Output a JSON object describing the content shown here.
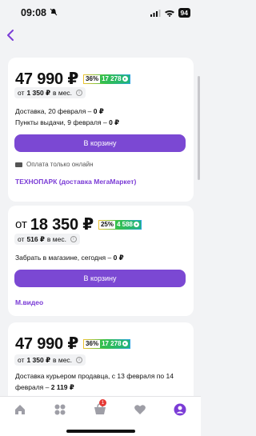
{
  "status": {
    "time": "09:08",
    "battery": "94"
  },
  "offers": [
    {
      "price": "47 990 ₽",
      "prefix": "",
      "bonus_pct": "36%",
      "bonus_pts": "17 278",
      "installment_prefix": "от",
      "installment_amount": "1 350 ₽",
      "installment_suffix": "в мес.",
      "delivery_line": "Доставка, 20 февраля –",
      "delivery_price": "0 ₽",
      "pickup_line": "Пункты выдачи, 9 февраля –",
      "pickup_price": "0 ₽",
      "cart_label": "В корзину",
      "payment_note": "Оплата только онлайн",
      "seller": "ТЕХНОПАРК (доставка МегаМаркет)"
    },
    {
      "price": "18 350 ₽",
      "prefix": "от",
      "bonus_pct": "25%",
      "bonus_pts": "4 588",
      "installment_prefix": "от",
      "installment_amount": "516 ₽",
      "installment_suffix": "в мес.",
      "store_line": "Забрать в магазине, сегодня –",
      "store_price": "0 ₽",
      "cart_label": "В корзину",
      "seller": "М.видео"
    },
    {
      "price": "47 990 ₽",
      "prefix": "",
      "bonus_pct": "36%",
      "bonus_pts": "17 278",
      "installment_prefix": "от",
      "installment_amount": "1 350 ₽",
      "installment_suffix": "в мес.",
      "courier_line": "Доставка курьером продавца, с 13 февраля по 14",
      "courier_line2": "февраля –",
      "courier_price": "2 119 ₽"
    }
  ],
  "tabbar": {
    "cart_count": "1"
  }
}
